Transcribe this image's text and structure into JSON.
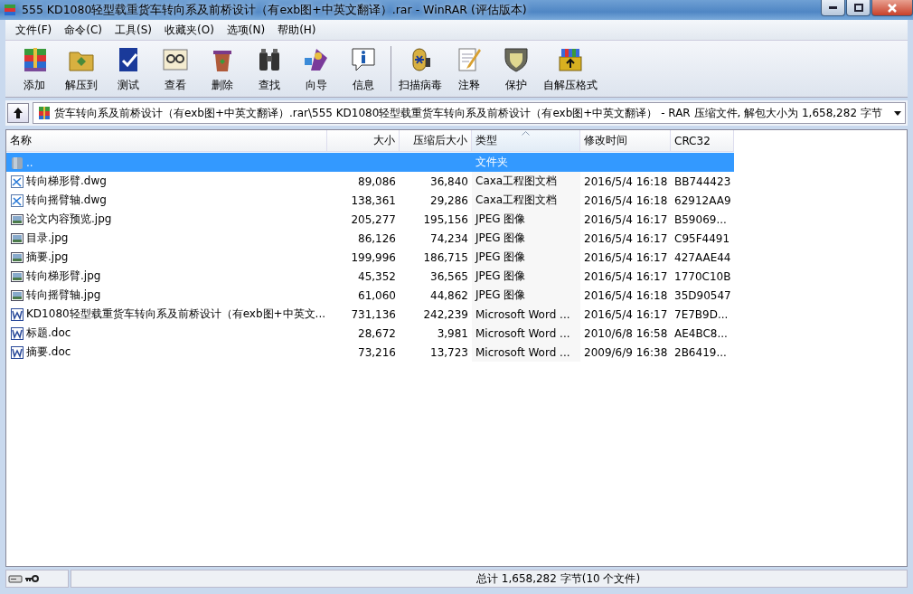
{
  "window": {
    "title": "555 KD1080轻型载重货车转向系及前桥设计（有exb图+中英文翻译）.rar - WinRAR (评估版本)"
  },
  "menu": [
    "文件(F)",
    "命令(C)",
    "工具(S)",
    "收藏夹(O)",
    "选项(N)",
    "帮助(H)"
  ],
  "toolbar": [
    {
      "label": "添加",
      "kind": "add"
    },
    {
      "label": "解压到",
      "kind": "extract"
    },
    {
      "label": "测试",
      "kind": "test"
    },
    {
      "label": "查看",
      "kind": "view"
    },
    {
      "label": "删除",
      "kind": "delete"
    },
    {
      "label": "查找",
      "kind": "find"
    },
    {
      "label": "向导",
      "kind": "wizard"
    },
    {
      "label": "信息",
      "kind": "info"
    },
    {
      "label": "扫描病毒",
      "kind": "scan"
    },
    {
      "label": "注释",
      "kind": "comment"
    },
    {
      "label": "保护",
      "kind": "protect"
    },
    {
      "label": "自解压格式",
      "kind": "sfx"
    }
  ],
  "address": {
    "path": "货车转向系及前桥设计（有exb图+中英文翻译）.rar\\555 KD1080轻型载重货车转向系及前桥设计（有exb图+中英文翻译） - RAR 压缩文件, 解包大小为 1,658,282 字节"
  },
  "table": {
    "columns": [
      {
        "label": "名称",
        "sorted": false
      },
      {
        "label": "大小",
        "sorted": false
      },
      {
        "label": "压缩后大小",
        "sorted": false
      },
      {
        "label": "类型",
        "sorted": true
      },
      {
        "label": "修改时间",
        "sorted": false
      },
      {
        "label": "CRC32",
        "sorted": false
      }
    ],
    "rows": [
      {
        "kind": "folder",
        "selected": true,
        "name": "..",
        "size": "",
        "packed": "",
        "type": "文件夹",
        "modified": "",
        "crc": ""
      },
      {
        "kind": "dwg",
        "selected": false,
        "name": "转向梯形臂.dwg",
        "size": "89,086",
        "packed": "36,840",
        "type": "Caxa工程图文档",
        "modified": "2016/5/4 16:18",
        "crc": "BB744423"
      },
      {
        "kind": "dwg",
        "selected": false,
        "name": "转向摇臂轴.dwg",
        "size": "138,361",
        "packed": "29,286",
        "type": "Caxa工程图文档",
        "modified": "2016/5/4 16:18",
        "crc": "62912AA9"
      },
      {
        "kind": "image",
        "selected": false,
        "name": "论文内容预览.jpg",
        "size": "205,277",
        "packed": "195,156",
        "type": "JPEG 图像",
        "modified": "2016/5/4 16:17",
        "crc": "B59069..."
      },
      {
        "kind": "image",
        "selected": false,
        "name": "目录.jpg",
        "size": "86,126",
        "packed": "74,234",
        "type": "JPEG 图像",
        "modified": "2016/5/4 16:17",
        "crc": "C95F4491"
      },
      {
        "kind": "image",
        "selected": false,
        "name": "摘要.jpg",
        "size": "199,996",
        "packed": "186,715",
        "type": "JPEG 图像",
        "modified": "2016/5/4 16:17",
        "crc": "427AAE44"
      },
      {
        "kind": "image",
        "selected": false,
        "name": "转向梯形臂.jpg",
        "size": "45,352",
        "packed": "36,565",
        "type": "JPEG 图像",
        "modified": "2016/5/4 16:17",
        "crc": "1770C10B"
      },
      {
        "kind": "image",
        "selected": false,
        "name": "转向摇臂轴.jpg",
        "size": "61,060",
        "packed": "44,862",
        "type": "JPEG 图像",
        "modified": "2016/5/4 16:18",
        "crc": "35D90547"
      },
      {
        "kind": "doc",
        "selected": false,
        "name": "KD1080轻型载重货车转向系及前桥设计（有exb图+中英文...",
        "size": "731,136",
        "packed": "242,239",
        "type": "Microsoft Word ...",
        "modified": "2016/5/4 16:17",
        "crc": "7E7B9D..."
      },
      {
        "kind": "doc",
        "selected": false,
        "name": "标题.doc",
        "size": "28,672",
        "packed": "3,981",
        "type": "Microsoft Word ...",
        "modified": "2010/6/8 16:58",
        "crc": "AE4BC8..."
      },
      {
        "kind": "doc",
        "selected": false,
        "name": "摘要.doc",
        "size": "73,216",
        "packed": "13,723",
        "type": "Microsoft Word ...",
        "modified": "2009/6/9 16:38",
        "crc": "2B6419..."
      }
    ]
  },
  "status_bar": {
    "text": "总计 1,658,282 字节(10 个文件)"
  }
}
